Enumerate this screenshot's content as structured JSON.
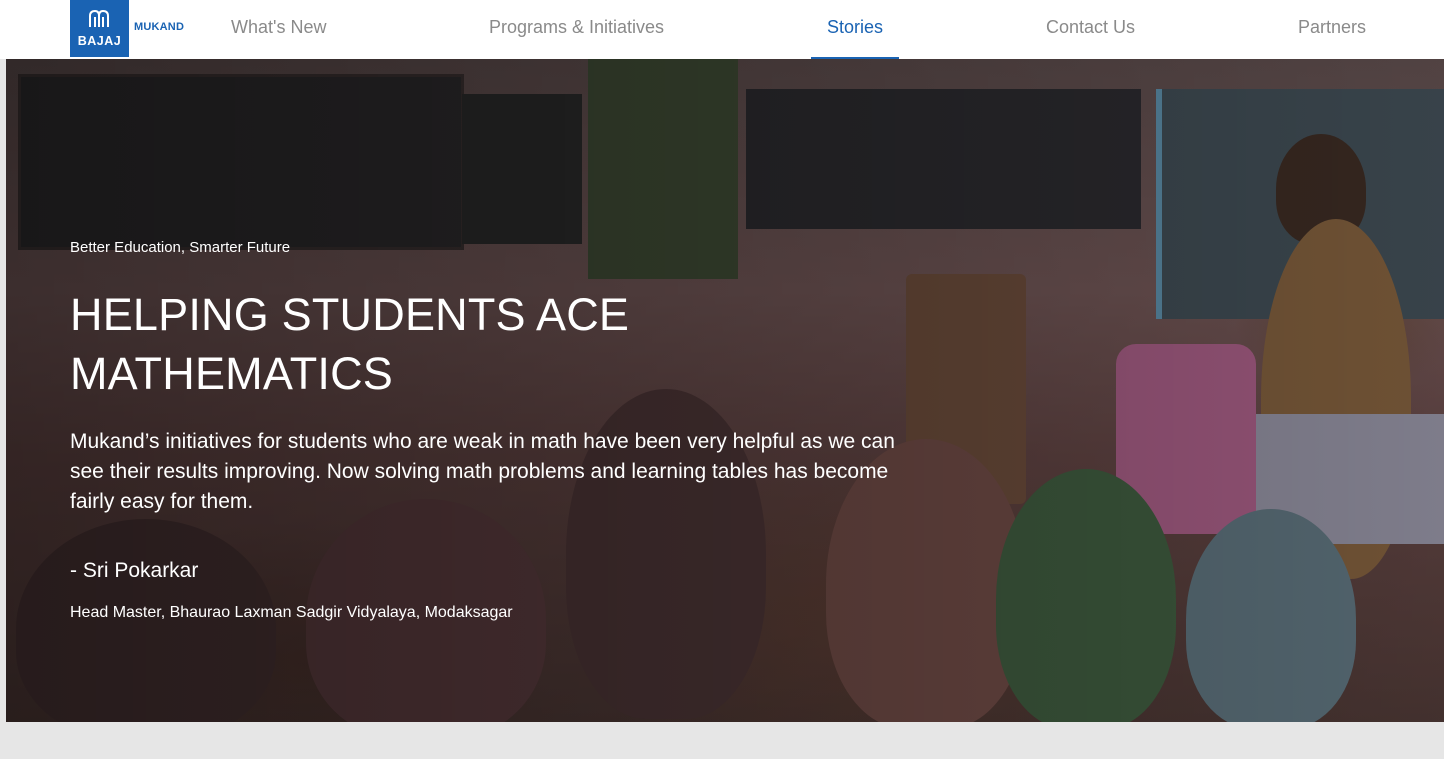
{
  "brand": {
    "logo_text": "BAJAJ",
    "logo_subtext": "MUKAND",
    "colors": {
      "primary": "#1a63b3",
      "nav_text": "#8a8a8a",
      "page_bg": "#e6e6e6"
    }
  },
  "nav": {
    "items": [
      {
        "label": "What's New",
        "active": false
      },
      {
        "label": "Programs & Initiatives",
        "active": false
      },
      {
        "label": "Stories",
        "active": true
      },
      {
        "label": "Contact Us",
        "active": false
      },
      {
        "label": "Partners",
        "active": false
      }
    ]
  },
  "hero": {
    "kicker": "Better Education, Smarter Future",
    "title_line1": "HELPING STUDENTS ACE",
    "title_line2": "MATHEMATICS",
    "quote": "Mukand’s initiatives for students who are weak in math have been very helpful as we can see their results improving. Now solving math problems and learning tables has become fairly easy for them.",
    "author": "- Sri Pokarkar",
    "author_role": "Head Master, Bhaurao Laxman Sadgir Vidyalaya, Modaksagar",
    "image_subject": "classroom-photo"
  }
}
